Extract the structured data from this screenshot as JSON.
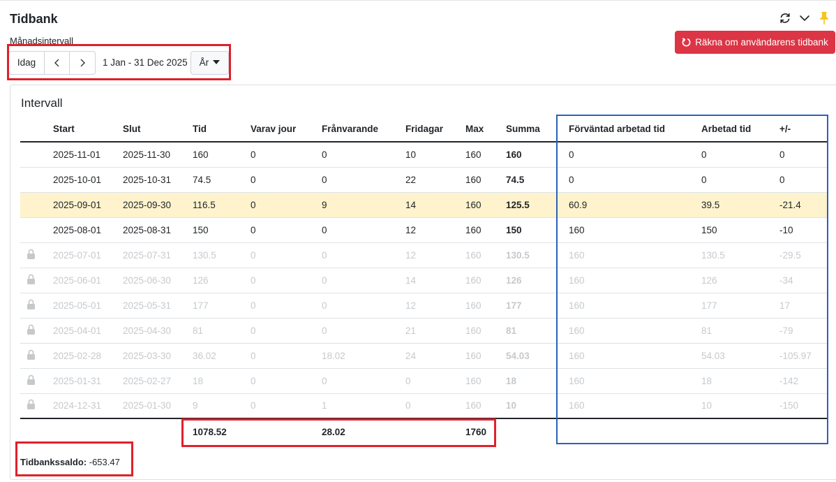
{
  "header": {
    "title": "Tidbank",
    "subtitle": "Månadsintervall",
    "recalc_label": "Räkna om användarens tidbank"
  },
  "nav": {
    "today_label": "Idag",
    "range_text": "1 Jan - 31 Dec 2025",
    "period_label": "År"
  },
  "card": {
    "title": "Intervall"
  },
  "table": {
    "headers": [
      "Start",
      "Slut",
      "Tid",
      "Varav jour",
      "Frånvarande",
      "Fridagar",
      "Max",
      "Summa",
      "Förväntad arbetad tid",
      "Arbetad tid",
      "+/-"
    ],
    "rows": [
      {
        "start": "2025-11-01",
        "slut": "2025-11-30",
        "tid": "160",
        "jour": "0",
        "franv": "0",
        "frid": "10",
        "max": "160",
        "summa": "160",
        "forv": "0",
        "arb": "0",
        "diff": "0",
        "locked": false,
        "highlight": false
      },
      {
        "start": "2025-10-01",
        "slut": "2025-10-31",
        "tid": "74.5",
        "jour": "0",
        "franv": "0",
        "frid": "22",
        "max": "160",
        "summa": "74.5",
        "forv": "0",
        "arb": "0",
        "diff": "0",
        "locked": false,
        "highlight": false
      },
      {
        "start": "2025-09-01",
        "slut": "2025-09-30",
        "tid": "116.5",
        "jour": "0",
        "franv": "9",
        "frid": "14",
        "max": "160",
        "summa": "125.5",
        "forv": "60.9",
        "arb": "39.5",
        "diff": "-21.4",
        "locked": false,
        "highlight": true
      },
      {
        "start": "2025-08-01",
        "slut": "2025-08-31",
        "tid": "150",
        "jour": "0",
        "franv": "0",
        "frid": "12",
        "max": "160",
        "summa": "150",
        "forv": "160",
        "arb": "150",
        "diff": "-10",
        "locked": false,
        "highlight": false
      },
      {
        "start": "2025-07-01",
        "slut": "2025-07-31",
        "tid": "130.5",
        "jour": "0",
        "franv": "0",
        "frid": "12",
        "max": "160",
        "summa": "130.5",
        "forv": "160",
        "arb": "130.5",
        "diff": "-29.5",
        "locked": true,
        "highlight": false
      },
      {
        "start": "2025-06-01",
        "slut": "2025-06-30",
        "tid": "126",
        "jour": "0",
        "franv": "0",
        "frid": "14",
        "max": "160",
        "summa": "126",
        "forv": "160",
        "arb": "126",
        "diff": "-34",
        "locked": true,
        "highlight": false
      },
      {
        "start": "2025-05-01",
        "slut": "2025-05-31",
        "tid": "177",
        "jour": "0",
        "franv": "0",
        "frid": "12",
        "max": "160",
        "summa": "177",
        "forv": "160",
        "arb": "177",
        "diff": "17",
        "locked": true,
        "highlight": false
      },
      {
        "start": "2025-04-01",
        "slut": "2025-04-30",
        "tid": "81",
        "jour": "0",
        "franv": "0",
        "frid": "21",
        "max": "160",
        "summa": "81",
        "forv": "160",
        "arb": "81",
        "diff": "-79",
        "locked": true,
        "highlight": false
      },
      {
        "start": "2025-02-28",
        "slut": "2025-03-30",
        "tid": "36.02",
        "jour": "0",
        "franv": "18.02",
        "frid": "24",
        "max": "160",
        "summa": "54.03",
        "forv": "160",
        "arb": "54.03",
        "diff": "-105.97",
        "locked": true,
        "highlight": false
      },
      {
        "start": "2025-01-31",
        "slut": "2025-02-27",
        "tid": "18",
        "jour": "0",
        "franv": "0",
        "frid": "0",
        "max": "160",
        "summa": "18",
        "forv": "160",
        "arb": "18",
        "diff": "-142",
        "locked": true,
        "highlight": false
      },
      {
        "start": "2024-12-31",
        "slut": "2025-01-30",
        "tid": "9",
        "jour": "0",
        "franv": "1",
        "frid": "0",
        "max": "160",
        "summa": "10",
        "forv": "160",
        "arb": "10",
        "diff": "-150",
        "locked": true,
        "highlight": false
      }
    ],
    "totals": {
      "tid": "1078.52",
      "franv": "28.02",
      "max": "1760"
    }
  },
  "saldo": {
    "label": "Tidbankssaldo:",
    "value": "-653.47"
  },
  "colors": {
    "danger": "#dc3545",
    "highlight_row": "#fff3cd",
    "annotation_red": "#e0202a",
    "annotation_blue": "#2a62b8",
    "pin": "#f5c518"
  },
  "icons": [
    "refresh-icon",
    "chevron-down-icon",
    "pin-icon",
    "rotate-icon",
    "chevron-left-icon",
    "chevron-right-icon",
    "caret-down-icon",
    "lock-icon"
  ]
}
